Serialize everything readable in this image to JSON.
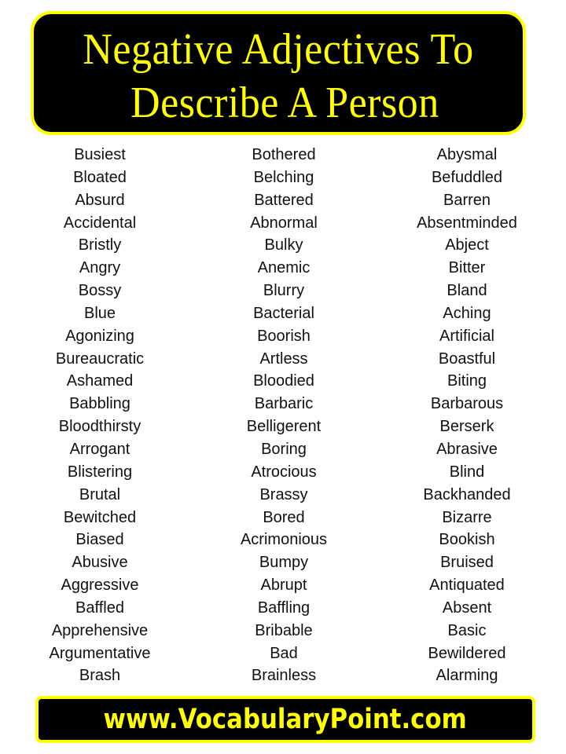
{
  "header": {
    "title_line_1": "Negative Adjectives To",
    "title_line_2": "Describe A Person",
    "text_color": "#ffff00",
    "background_color": "#000000"
  },
  "columns": [
    {
      "words": [
        "Busiest",
        "Bloated",
        "Absurd",
        "Accidental",
        "Bristly",
        "Angry",
        "Bossy",
        "Blue",
        "Agonizing",
        "Bureaucratic",
        "Ashamed",
        "Babbling",
        "Bloodthirsty",
        "Arrogant",
        "Blistering",
        "Brutal",
        "Bewitched",
        "Biased",
        "Abusive",
        "Aggressive",
        "Baffled",
        "Apprehensive",
        "Argumentative",
        "Brash"
      ]
    },
    {
      "words": [
        "Bothered",
        "Belching",
        "Battered",
        "Abnormal",
        "Bulky",
        "Anemic",
        "Blurry",
        "Bacterial",
        "Boorish",
        "Artless",
        "Bloodied",
        "Barbaric",
        "Belligerent",
        "Boring",
        "Atrocious",
        "Brassy",
        "Bored",
        "Acrimonious",
        "Bumpy",
        "Abrupt",
        "Baffling",
        "Bribable",
        "Bad",
        "Brainless"
      ]
    },
    {
      "words": [
        "Abysmal",
        "Befuddled",
        "Barren",
        "Absentminded",
        "Abject",
        "Bitter",
        "Bland",
        "Aching",
        "Artificial",
        "Boastful",
        "Biting",
        "Barbarous",
        "Berserk",
        "Abrasive",
        "Blind",
        "Backhanded",
        "Bizarre",
        "Bookish",
        "Bruised",
        "Antiquated",
        "Absent",
        "Basic",
        "Bewildered",
        "Alarming"
      ]
    }
  ],
  "footer": {
    "website": "www.VocabularyPoint.com"
  }
}
